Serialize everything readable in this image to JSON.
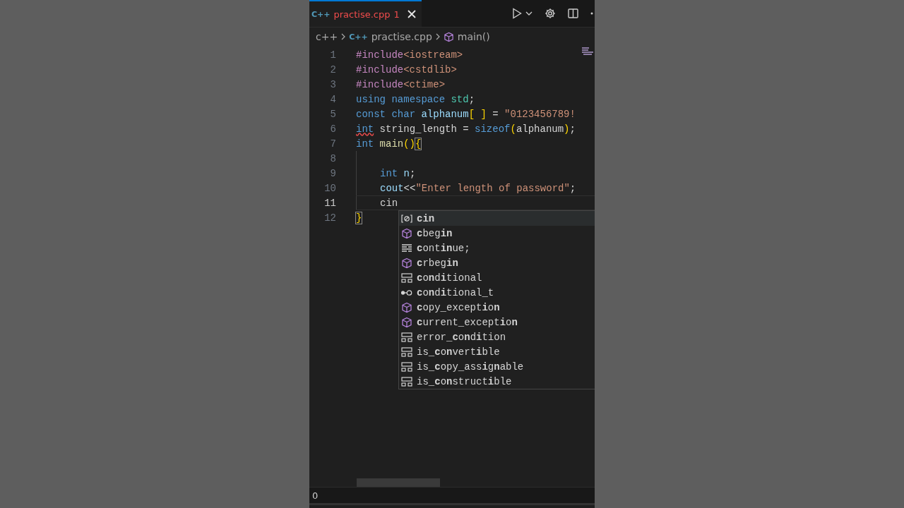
{
  "tab": {
    "lang_badge": "C++",
    "title": "practise.cpp",
    "problems": "1",
    "selected": true,
    "has_errors": true
  },
  "breadcrumb": [
    {
      "kind": "folder",
      "label": "c++"
    },
    {
      "kind": "file",
      "badge": "C++",
      "label": "practise.cpp"
    },
    {
      "kind": "function",
      "label": "main()"
    }
  ],
  "lines": [
    {
      "n": "1",
      "code": [
        {
          "kind": "preproc",
          "text": "#include"
        },
        {
          "kind": "header",
          "text": "<iostream>"
        }
      ]
    },
    {
      "n": "2",
      "code": [
        {
          "kind": "preproc",
          "text": "#include"
        },
        {
          "kind": "header",
          "text": "<cstdlib>"
        }
      ]
    },
    {
      "n": "3",
      "code": [
        {
          "kind": "preproc",
          "text": "#include"
        },
        {
          "kind": "header",
          "text": "<ctime>"
        }
      ]
    },
    {
      "n": "4",
      "code": [
        {
          "kind": "keyword",
          "text": "using "
        },
        {
          "kind": "keyword",
          "text": "namespace "
        },
        {
          "kind": "type",
          "text": "std"
        },
        {
          "kind": "plain",
          "text": ";"
        }
      ]
    },
    {
      "n": "5",
      "code": [
        {
          "kind": "keyword",
          "text": "const "
        },
        {
          "kind": "keyword",
          "text": "char "
        },
        {
          "kind": "variable",
          "text": "alphanum"
        },
        {
          "kind": "bracket",
          "text": "[ ]"
        },
        {
          "kind": "plain",
          "text": " = "
        },
        {
          "kind": "string",
          "text": "\"0123456789!"
        }
      ]
    },
    {
      "n": "6",
      "code": [
        {
          "kind": "keyword_error",
          "text": "int"
        },
        {
          "kind": "plain",
          "text": " string_length = "
        },
        {
          "kind": "keyword",
          "text": "sizeof"
        },
        {
          "kind": "bracket",
          "text": "("
        },
        {
          "kind": "plain",
          "text": "alphanum"
        },
        {
          "kind": "bracket",
          "text": ")"
        },
        {
          "kind": "plain",
          "text": ";"
        }
      ]
    },
    {
      "n": "7",
      "code": [
        {
          "kind": "keyword",
          "text": "int "
        },
        {
          "kind": "function",
          "text": "main"
        },
        {
          "kind": "bracket",
          "text": "()"
        },
        {
          "kind": "bracket_match",
          "text": "{"
        }
      ]
    },
    {
      "n": "8",
      "indent": true,
      "current": false
    },
    {
      "n": "9",
      "indent": true,
      "current": false,
      "code": [
        {
          "kind": "keyword",
          "text": "int "
        },
        {
          "kind": "variable",
          "text": "n"
        },
        {
          "kind": "plain",
          "text": ";"
        }
      ]
    },
    {
      "n": "10",
      "indent": true,
      "current": false,
      "code": [
        {
          "kind": "variable",
          "text": "cout"
        },
        {
          "kind": "plain",
          "text": "<<"
        },
        {
          "kind": "string",
          "text": "\"Enter length of password\""
        },
        {
          "kind": "plain",
          "text": ";"
        }
      ]
    },
    {
      "n": "11",
      "indent": true,
      "current": true,
      "code": [
        {
          "kind": "plain",
          "text": "cin"
        }
      ]
    },
    {
      "n": "12",
      "code": [
        {
          "kind": "bracket_match",
          "text": "}"
        }
      ]
    }
  ],
  "suggestions": [
    {
      "kind": "variable",
      "label": "**cin**",
      "selected": true
    },
    {
      "kind": "method",
      "label": "**c**beg**in**",
      "selected": false
    },
    {
      "kind": "snippet",
      "label": "**c**ont**in**ue;",
      "selected": false
    },
    {
      "kind": "method",
      "label": "**c**rbeg**in**",
      "selected": false
    },
    {
      "kind": "struct",
      "label": "**c**o**n**d**i**tional",
      "selected": false
    },
    {
      "kind": "typedef",
      "label": "**c**o**n**d**i**tional_t",
      "selected": false
    },
    {
      "kind": "method",
      "label": "**c**opy_except**i**o**n**",
      "selected": false
    },
    {
      "kind": "method",
      "label": "**c**urrent_except**i**o**n**",
      "selected": false
    },
    {
      "kind": "struct",
      "label": "error_**c**o**n**d**i**tion",
      "selected": false
    },
    {
      "kind": "struct",
      "label": "is_**c**o**n**vert**i**ble",
      "selected": false
    },
    {
      "kind": "struct",
      "label": "is_**c**opy_ass**i**g**n**able",
      "selected": false
    },
    {
      "kind": "struct",
      "label": "is_**c**o**n**struct**i**ble",
      "selected": false
    }
  ],
  "status_bar": {
    "text": "0"
  }
}
